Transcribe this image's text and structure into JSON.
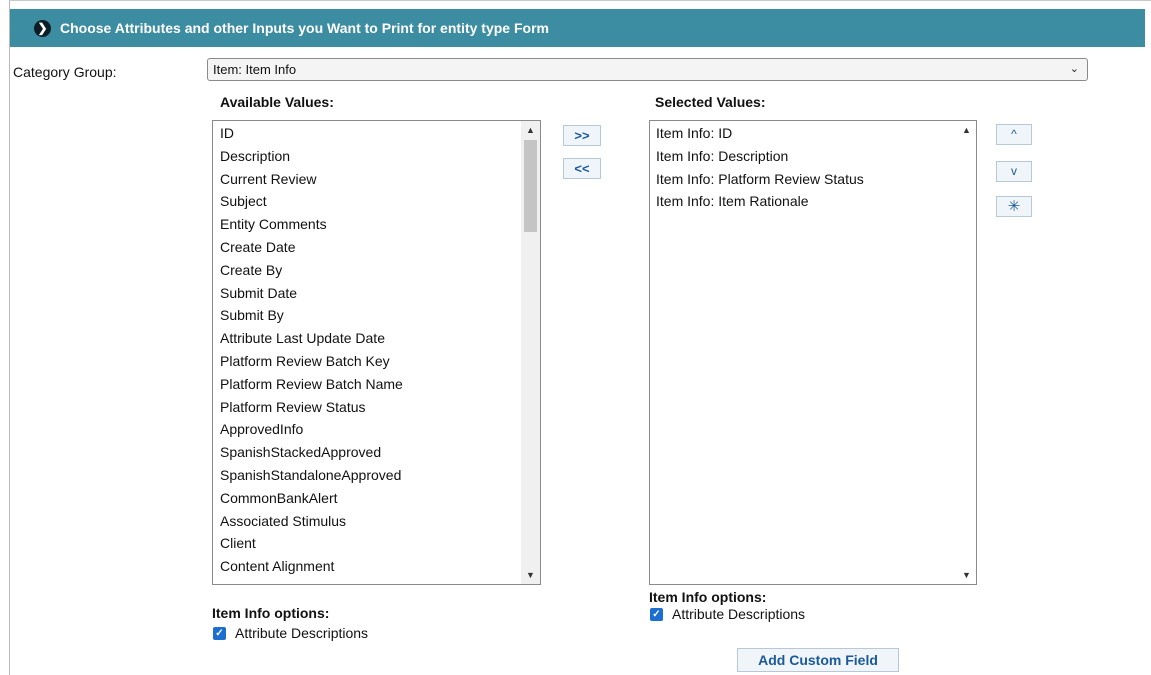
{
  "header": {
    "title": "Choose Attributes and other Inputs you Want to Print for entity type Form",
    "icon": "chevron-right-circle-icon"
  },
  "category_group": {
    "label": "Category Group:",
    "selected": "Item: Item Info"
  },
  "available": {
    "title": "Available Values:",
    "items": [
      "ID",
      "Description",
      "Current Review",
      "Subject",
      "Entity Comments",
      "Create Date",
      "Create By",
      "Submit Date",
      "Submit By",
      "Attribute Last Update Date",
      "Platform Review Batch Key",
      "Platform Review Batch Name",
      "Platform Review Status",
      "ApprovedInfo",
      "SpanishStackedApproved",
      "SpanishStandaloneApproved",
      "CommonBankAlert",
      "Associated Stimulus",
      "Client",
      "Content Alignment"
    ]
  },
  "selected": {
    "title": "Selected Values:",
    "items": [
      "Item Info: ID",
      "Item Info: Description",
      "Item Info: Platform Review Status",
      "Item Info: Item Rationale"
    ]
  },
  "transfer_buttons": {
    "add": ">>",
    "remove": "<<"
  },
  "order_buttons": {
    "up": "^",
    "down": "v",
    "reset": "✳"
  },
  "options_left": {
    "title": "Item Info options:",
    "checkbox_label": "Attribute Descriptions",
    "checked": true
  },
  "options_right": {
    "title": "Item Info options:",
    "checkbox_label": "Attribute Descriptions",
    "checked": true
  },
  "add_custom_field": "Add Custom Field",
  "colors": {
    "header_bg": "#3c8ca2",
    "button_text": "#1a5a9a",
    "checkbox": "#1c6fd0"
  }
}
